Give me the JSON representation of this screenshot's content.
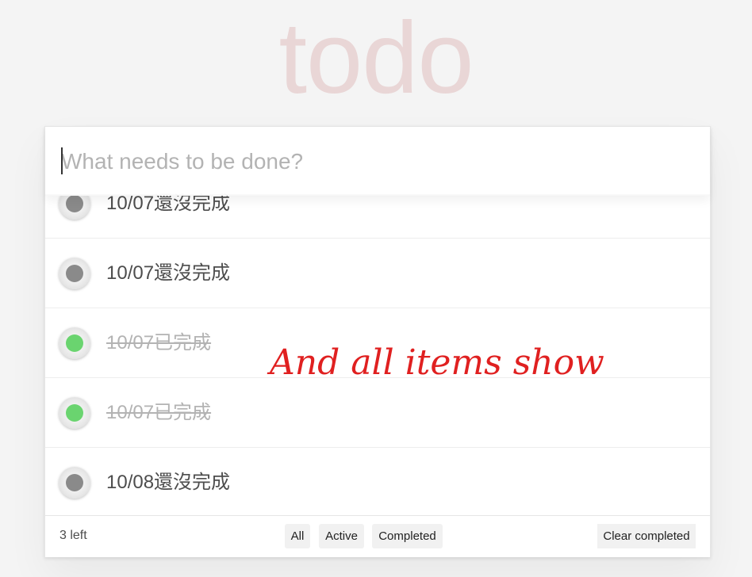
{
  "app": {
    "title": "todo"
  },
  "new_todo": {
    "placeholder": "What needs to be done?",
    "value": ""
  },
  "todos": [
    {
      "label": "10/07還沒完成",
      "completed": false
    },
    {
      "label": "10/07還沒完成",
      "completed": false
    },
    {
      "label": "10/07已完成",
      "completed": true
    },
    {
      "label": "10/07已完成",
      "completed": true
    },
    {
      "label": "10/08還沒完成",
      "completed": false
    }
  ],
  "footer": {
    "count_text": "3 left",
    "filters": {
      "all": "All",
      "active": "Active",
      "completed": "Completed"
    },
    "clear_completed": "Clear completed"
  },
  "annotation": {
    "text": "And all items show !",
    "color": "#e02020"
  },
  "colors": {
    "background": "#f4f4f4",
    "title": "rgba(175,47,47,0.15)",
    "incomplete_dot": "#8a8a8a",
    "complete_dot": "#6ad46f",
    "completed_text": "#b3b3b3"
  }
}
